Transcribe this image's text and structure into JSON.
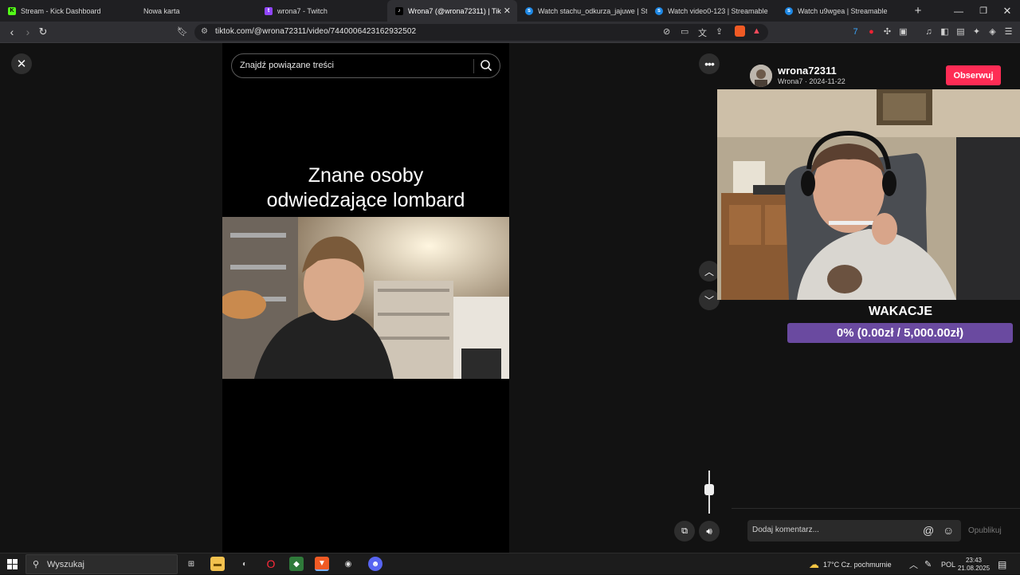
{
  "browser": {
    "tabs": [
      {
        "title": "Stream - Kick Dashboard",
        "icon": "kick-icon"
      },
      {
        "title": "Nowa karta",
        "icon": "none"
      },
      {
        "title": "wrona7 - Twitch",
        "icon": "twitch-icon"
      },
      {
        "title": "Wrona7 (@wrona72311) | Tik",
        "icon": "tiktok-icon",
        "active": true
      },
      {
        "title": "Watch stachu_odkurza_jajuwe | Strea",
        "icon": "streamable-icon"
      },
      {
        "title": "Watch video0-123 | Streamable",
        "icon": "streamable-icon"
      },
      {
        "title": "Watch u9wgea | Streamable",
        "icon": "streamable-icon"
      }
    ],
    "url": "tiktok.com/@wrona72311/video/7440006423162932502"
  },
  "video": {
    "search_placeholder": "Znajdź powiązane treści",
    "caption_line1": "Znane osoby",
    "caption_line2": "odwiedzające lombard"
  },
  "profile": {
    "username": "wrona72311",
    "subline": "Wrona7 · 2024-11-22",
    "follow_label": "Obserwuj"
  },
  "goal": {
    "title": "WAKACJE",
    "progress_text": "0% (0.00zł / 5,000.00zł)",
    "progress_fraction": 0
  },
  "comments": {
    "placeholder": "Dodaj komentarz...",
    "publish_label": "Opublikuj"
  },
  "taskbar": {
    "search_placeholder": "Wyszukaj",
    "weather": "17°C",
    "weather_desc": "Cz. pochmurnie",
    "lang": "POL",
    "time": "23:43",
    "date": "21.08.2025"
  },
  "colors": {
    "follow": "#fe2c55",
    "goal_bar": "#6a4aa0",
    "page_bg": "#121212"
  }
}
